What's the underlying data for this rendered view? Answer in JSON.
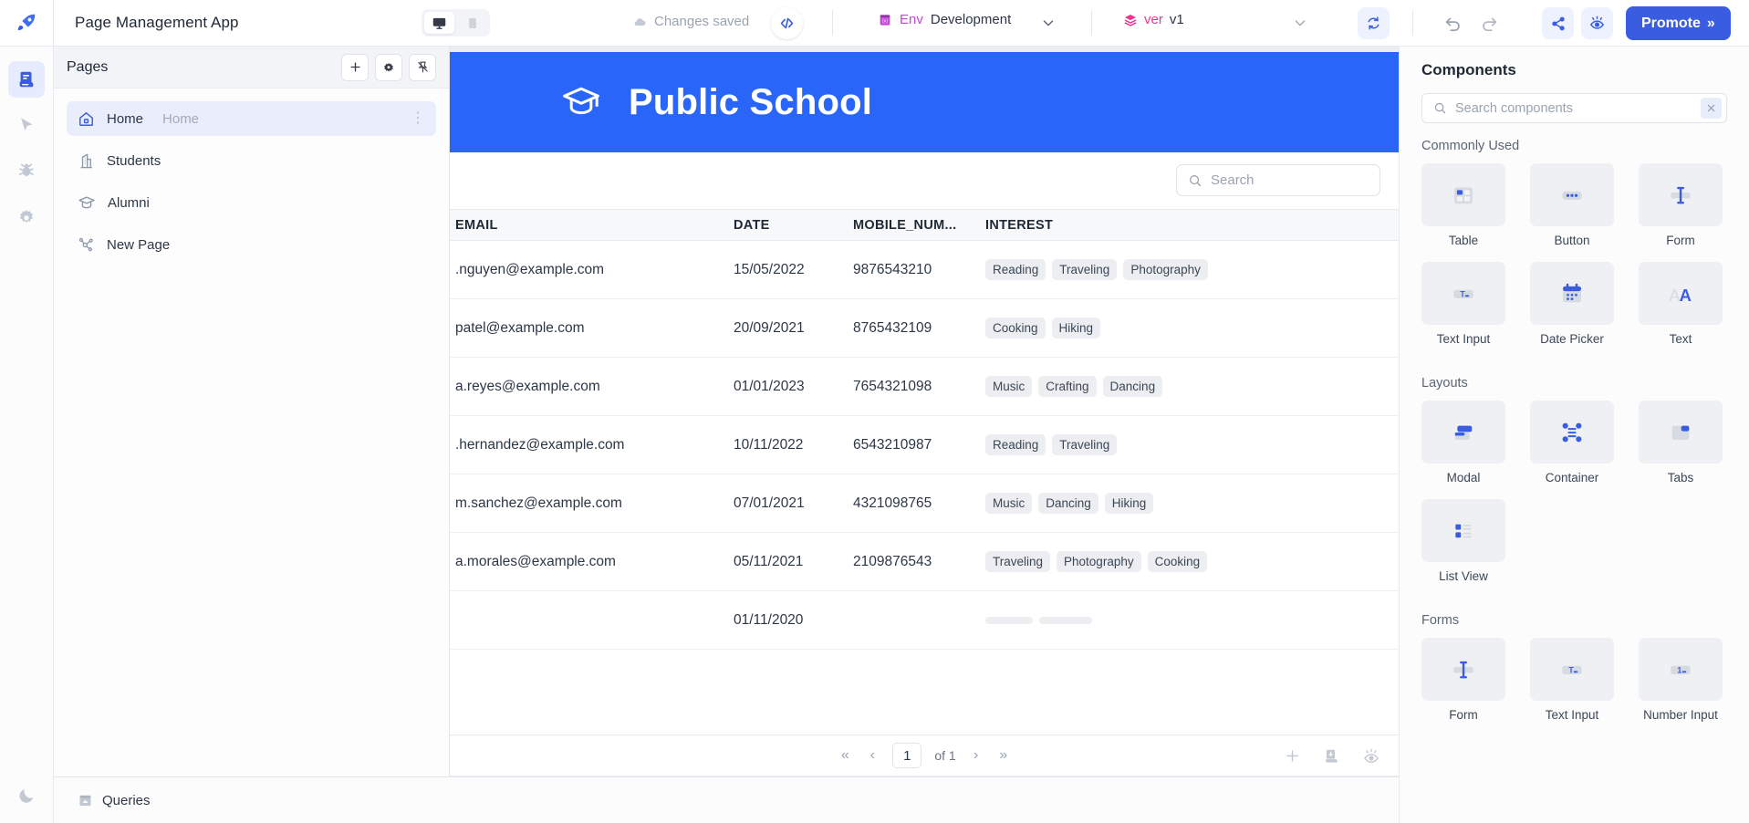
{
  "topbar": {
    "app_title": "Page Management App",
    "device_desktop_icon": "desktop-icon",
    "device_mobile_icon": "mobile-icon",
    "changes_status": "Changes saved",
    "code_icon": "code-brackets-icon",
    "env_label": "Env",
    "env_value": "Development",
    "version_label": "ver",
    "version_value": "v1",
    "refresh_icon": "refresh-icon",
    "undo_icon": "undo-icon",
    "redo_icon": "redo-icon",
    "share_icon": "share-icon",
    "preview_icon": "preview-eye-icon",
    "promote_label": "Promote",
    "promote_chevron": "»"
  },
  "rail": {
    "items": [
      {
        "name": "pages-icon",
        "active": true
      },
      {
        "name": "cursor-inspector-icon",
        "active": false
      },
      {
        "name": "debugger-bug-icon",
        "active": false
      },
      {
        "name": "settings-gear-icon",
        "active": false
      }
    ],
    "theme_toggle_icon": "moon-icon"
  },
  "pages": {
    "title": "Pages",
    "add_icon": "plus-icon",
    "settings_icon": "gear-icon",
    "pin_icon": "unpin-icon",
    "items": [
      {
        "label": "Home",
        "sub": "Home",
        "icon": "home-icon",
        "active": true
      },
      {
        "label": "Students",
        "sub": "",
        "icon": "building-icon",
        "active": false
      },
      {
        "label": "Alumni",
        "sub": "",
        "icon": "graduation-cap-icon",
        "active": false
      },
      {
        "label": "New Page",
        "sub": "",
        "icon": "node-graph-icon",
        "active": false
      }
    ],
    "overflow_icon": "kebab-menu-icon"
  },
  "canvas": {
    "banner": {
      "icon": "graduation-cap-icon",
      "title": "Public School",
      "bg_color": "#2a65fa"
    },
    "search": {
      "placeholder": "Search",
      "value": "",
      "icon": "search-icon"
    },
    "table": {
      "columns": [
        "EMAIL",
        "DATE",
        "MOBILE_NUM...",
        "INTEREST"
      ],
      "rows": [
        {
          "email": ".nguyen@example.com",
          "date": "15/05/2022",
          "mobile": "9876543210",
          "interest": [
            "Reading",
            "Traveling",
            "Photography"
          ]
        },
        {
          "email": "patel@example.com",
          "date": "20/09/2021",
          "mobile": "8765432109",
          "interest": [
            "Cooking",
            "Hiking"
          ]
        },
        {
          "email": "a.reyes@example.com",
          "date": "01/01/2023",
          "mobile": "7654321098",
          "interest": [
            "Music",
            "Crafting",
            "Dancing"
          ]
        },
        {
          "email": ".hernandez@example.com",
          "date": "10/11/2022",
          "mobile": "6543210987",
          "interest": [
            "Reading",
            "Traveling"
          ]
        },
        {
          "email": "m.sanchez@example.com",
          "date": "07/01/2021",
          "mobile": "4321098765",
          "interest": [
            "Music",
            "Dancing",
            "Hiking"
          ]
        },
        {
          "email": "a.morales@example.com",
          "date": "05/11/2021",
          "mobile": "2109876543",
          "interest": [
            "Traveling",
            "Photography",
            "Cooking"
          ]
        },
        {
          "email": "",
          "date": "01/11/2020",
          "mobile": "",
          "interest": [
            "",
            ""
          ]
        }
      ]
    },
    "pagination": {
      "first_icon": "«",
      "prev_icon": "‹",
      "page_value": "1",
      "of_text": "of 1",
      "next_icon": "›",
      "last_icon": "»",
      "add_icon": "plus-icon",
      "download_icon": "download-icon",
      "visibility_icon": "eye-icon"
    }
  },
  "components": {
    "title": "Components",
    "search": {
      "placeholder": "Search components",
      "value": "",
      "icon": "search-icon",
      "clear_icon": "close-icon"
    },
    "groups": [
      {
        "name": "Commonly Used",
        "items": [
          {
            "label": "Table",
            "icon": "table-icon"
          },
          {
            "label": "Button",
            "icon": "button-icon"
          },
          {
            "label": "Form",
            "icon": "form-icon"
          },
          {
            "label": "Text Input",
            "icon": "text-input-icon"
          },
          {
            "label": "Date Picker",
            "icon": "calendar-icon"
          },
          {
            "label": "Text",
            "icon": "text-icon"
          }
        ]
      },
      {
        "name": "Layouts",
        "items": [
          {
            "label": "Modal",
            "icon": "modal-icon"
          },
          {
            "label": "Container",
            "icon": "container-icon"
          },
          {
            "label": "Tabs",
            "icon": "tabs-icon"
          },
          {
            "label": "List View",
            "icon": "list-view-icon"
          }
        ]
      },
      {
        "name": "Forms",
        "items": [
          {
            "label": "Form",
            "icon": "form-icon"
          },
          {
            "label": "Text Input",
            "icon": "text-input-icon"
          },
          {
            "label": "Number Input",
            "icon": "number-input-icon"
          }
        ]
      }
    ]
  },
  "bottom": {
    "queries_label": "Queries",
    "queries_icon": "queries-panel-icon"
  },
  "colors": {
    "accent": "#3a5ce0",
    "banner": "#2a65fa",
    "env": "#c248d6",
    "version": "#e8368f"
  }
}
